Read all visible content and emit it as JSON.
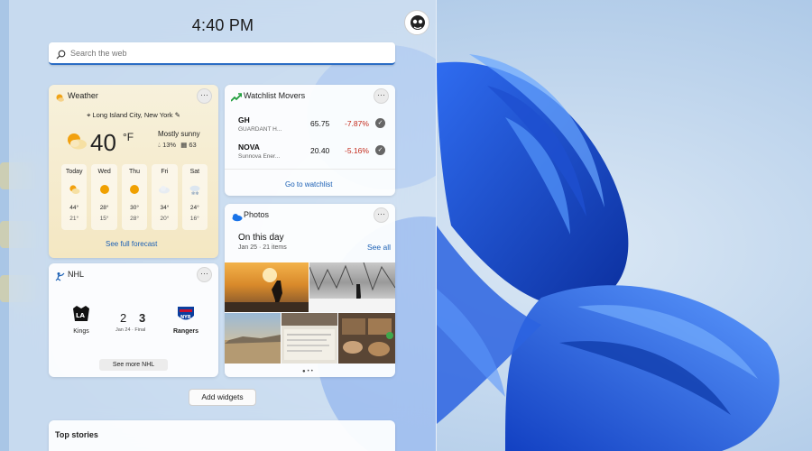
{
  "clock": {
    "time": "4:40 PM"
  },
  "search": {
    "placeholder": "Search the web"
  },
  "weather": {
    "title": "Weather",
    "location": "Long Island City, New York",
    "temperature": "40",
    "unit": "°F",
    "condition": "Mostly sunny",
    "precip": "13%",
    "aqi": "63",
    "forecast": [
      {
        "day": "Today",
        "icon": "partly-sunny-icon",
        "high": "44°",
        "low": "21°"
      },
      {
        "day": "Wed",
        "icon": "sun-icon",
        "high": "28°",
        "low": "15°"
      },
      {
        "day": "Thu",
        "icon": "sun-icon",
        "high": "30°",
        "low": "28°"
      },
      {
        "day": "Fri",
        "icon": "cloudy-icon",
        "high": "34°",
        "low": "20°"
      },
      {
        "day": "Sat",
        "icon": "snow-icon",
        "high": "24°",
        "low": "16°"
      }
    ],
    "link": "See full forecast"
  },
  "watchlist": {
    "title": "Watchlist Movers",
    "stocks": [
      {
        "symbol": "GH",
        "name": "GUARDANT H...",
        "price": "65.75",
        "change": "-7.87%"
      },
      {
        "symbol": "NOVA",
        "name": "Sunnova Ener...",
        "price": "20.40",
        "change": "-5.16%"
      }
    ],
    "link": "Go to watchlist"
  },
  "nhl": {
    "title": "NHL",
    "home": {
      "name": "Kings",
      "score": "2"
    },
    "away": {
      "name": "Rangers",
      "score": "3"
    },
    "date": "Jan 24 · Final",
    "more": "See more NHL"
  },
  "photos": {
    "title": "Photos",
    "heading": "On this day",
    "sub": "Jan 25 · 21 items",
    "see_all": "See all"
  },
  "add_widgets": "Add widgets",
  "top_stories": {
    "title": "Top stories"
  },
  "colors": {
    "accent": "#1a5fb4",
    "negative": "#c42b1c",
    "panel": "#d2e2f3"
  }
}
